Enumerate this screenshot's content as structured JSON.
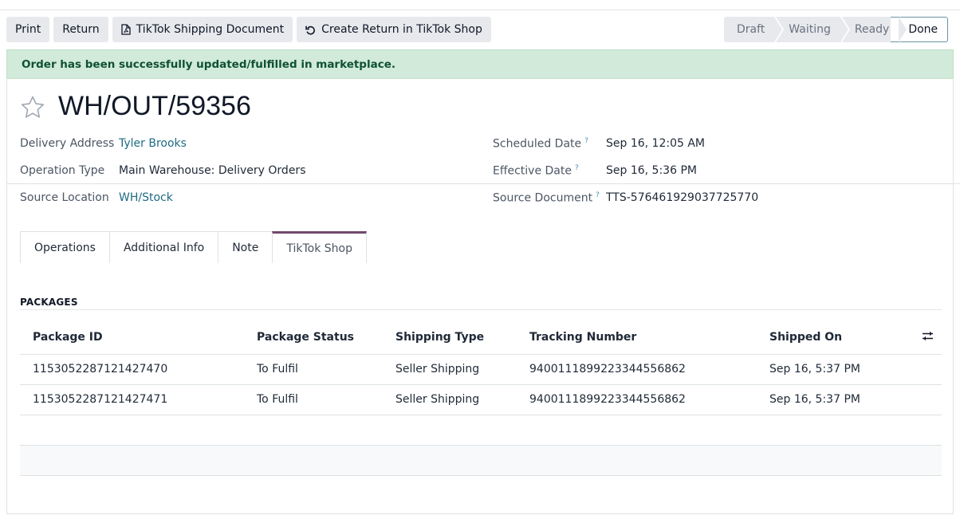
{
  "toolbar": {
    "print_label": "Print",
    "return_label": "Return",
    "tiktok_doc_label": "TikTok Shipping Document",
    "tiktok_return_label": "Create Return in TikTok Shop"
  },
  "status": {
    "stages": [
      "Draft",
      "Waiting",
      "Ready",
      "Done"
    ],
    "active": "Done"
  },
  "alert": {
    "message": "Order has been successfully updated/fulfilled in marketplace."
  },
  "record": {
    "name": "WH/OUT/59356",
    "left_fields": [
      {
        "label": "Delivery Address",
        "value": "Tyler Brooks"
      },
      {
        "label": "Operation Type",
        "value": "Main Warehouse: Delivery Orders"
      },
      {
        "label": "Source Location",
        "value": "WH/Stock"
      }
    ],
    "right_fields": [
      {
        "label": "Scheduled Date",
        "help": "?",
        "value": "Sep 16, 12:05 AM"
      },
      {
        "label": "Effective Date",
        "help": "?",
        "value": "Sep 16, 5:36 PM"
      },
      {
        "label": "Source Document",
        "help": "?",
        "value": "TTS-576461929037725770"
      }
    ]
  },
  "tabs": [
    "Operations",
    "Additional Info",
    "Note",
    "TikTok Shop"
  ],
  "active_tab": "TikTok Shop",
  "packages": {
    "heading": "PACKAGES",
    "columns": [
      "Package ID",
      "Package Status",
      "Shipping Type",
      "Tracking Number",
      "Shipped On"
    ],
    "rows": [
      [
        "1153052287121427470",
        "To Fulfil",
        "Seller Shipping",
        "9400111899223344556862",
        "Sep 16, 5:37 PM"
      ],
      [
        "1153052287121427471",
        "To Fulfil",
        "Seller Shipping",
        "9400111899223344556862",
        "Sep 16, 5:37 PM"
      ]
    ]
  },
  "colors": {
    "accent": "#71496b",
    "link": "#1e6b83",
    "alert_bg": "#d1ead9",
    "alert_text": "#0f5132"
  },
  "icons": [
    "file-pdf-icon",
    "undo-icon",
    "star-icon",
    "column-settings-icon"
  ]
}
